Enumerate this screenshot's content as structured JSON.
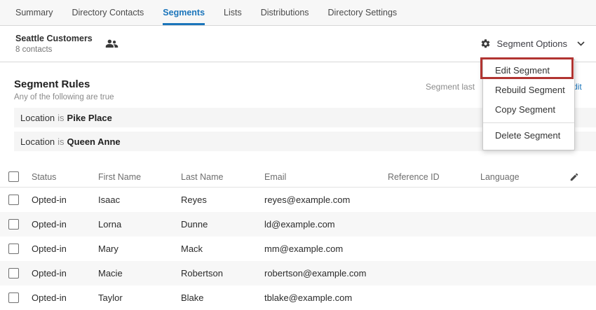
{
  "tab_bar": {
    "tabs": [
      {
        "label": "Summary",
        "active": false
      },
      {
        "label": "Directory Contacts",
        "active": false
      },
      {
        "label": "Segments",
        "active": true
      },
      {
        "label": "Lists",
        "active": false
      },
      {
        "label": "Distributions",
        "active": false
      },
      {
        "label": "Directory Settings",
        "active": false
      }
    ]
  },
  "header": {
    "title": "Seattle Customers",
    "contact_count": "8 contacts",
    "options_button_label": "Segment Options"
  },
  "options_menu": {
    "items": [
      {
        "label": "Edit Segment",
        "highlighted": true
      },
      {
        "label": "Rebuild Segment"
      },
      {
        "label": "Copy Segment"
      },
      {
        "label": "Delete Segment",
        "divider_before": true
      }
    ]
  },
  "segment_rules": {
    "title": "Segment Rules",
    "condition_text": "Any of the following are true",
    "rules": [
      {
        "field": "Location",
        "operator": "is",
        "value": "Pike Place"
      },
      {
        "field": "Location",
        "operator": "is",
        "value": "Queen Anne"
      }
    ],
    "last_refreshed_prefix": "Segment last",
    "edit_link": "Edit"
  },
  "contacts_table": {
    "columns": [
      "Status",
      "First Name",
      "Last Name",
      "Email",
      "Reference ID",
      "Language"
    ],
    "rows": [
      {
        "status": "Opted-in",
        "first_name": "Isaac",
        "last_name": "Reyes",
        "email": "reyes@example.com",
        "reference_id": "",
        "language": ""
      },
      {
        "status": "Opted-in",
        "first_name": "Lorna",
        "last_name": "Dunne",
        "email": "ld@example.com",
        "reference_id": "",
        "language": ""
      },
      {
        "status": "Opted-in",
        "first_name": "Mary",
        "last_name": "Mack",
        "email": "mm@example.com",
        "reference_id": "",
        "language": ""
      },
      {
        "status": "Opted-in",
        "first_name": "Macie",
        "last_name": "Robertson",
        "email": "robertson@example.com",
        "reference_id": "",
        "language": ""
      },
      {
        "status": "Opted-in",
        "first_name": "Taylor",
        "last_name": "Blake",
        "email": "tblake@example.com",
        "reference_id": "",
        "language": "",
        "partially_visible": true
      }
    ]
  },
  "colors": {
    "accent_blue": "#1B75BB",
    "annotation_red": "#B13431",
    "row_stripe": "#F7F7F7"
  }
}
